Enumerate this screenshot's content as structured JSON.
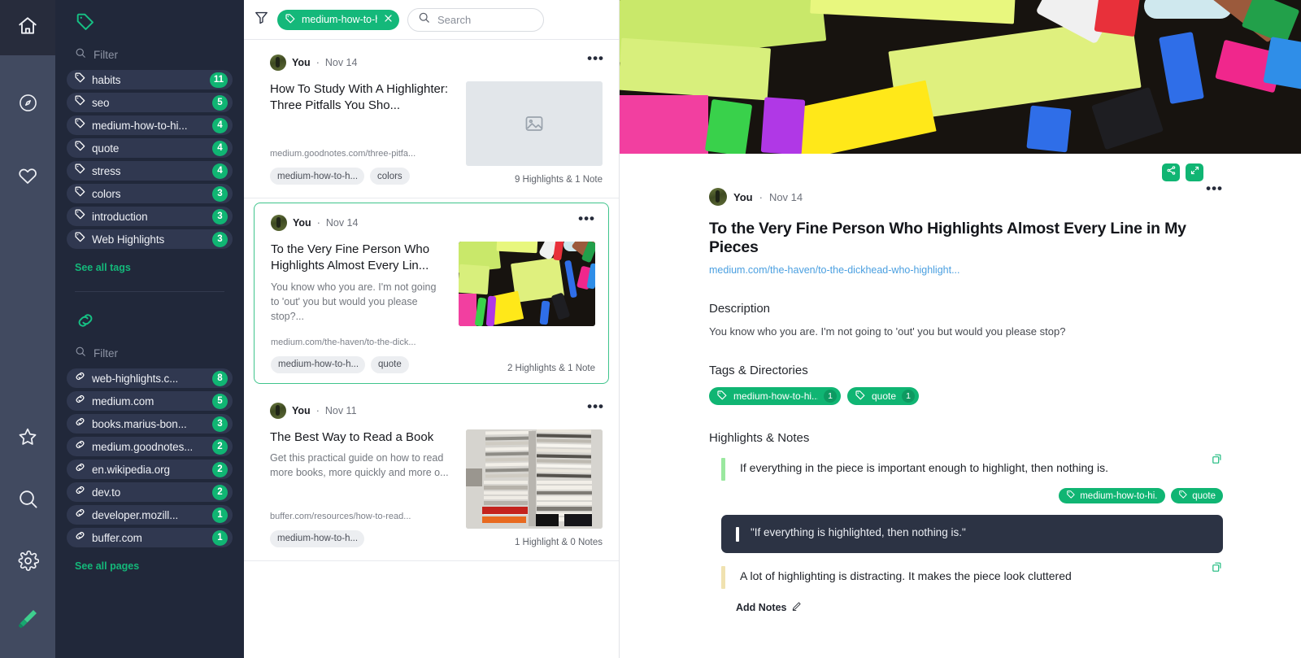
{
  "rail": {
    "icons": [
      {
        "name": "home-icon",
        "label": "Home"
      },
      {
        "name": "compass-icon",
        "label": "Discover"
      },
      {
        "name": "heart-icon",
        "label": "Favorites"
      },
      {
        "name": "star-icon",
        "label": "Starred"
      },
      {
        "name": "search-icon",
        "label": "Search"
      },
      {
        "name": "gear-icon",
        "label": "Settings"
      },
      {
        "name": "highlighter-icon",
        "label": "Highlighter"
      }
    ]
  },
  "sidebar": {
    "tags": {
      "header_icon": "tag-icon",
      "filter_placeholder": "Filter",
      "items": [
        {
          "label": "habits",
          "count": "11"
        },
        {
          "label": "seo",
          "count": "5"
        },
        {
          "label": "medium-how-to-hi...",
          "count": "4"
        },
        {
          "label": "quote",
          "count": "4"
        },
        {
          "label": "stress",
          "count": "4"
        },
        {
          "label": "colors",
          "count": "3"
        },
        {
          "label": "introduction",
          "count": "3"
        },
        {
          "label": "Web Highlights",
          "count": "3"
        }
      ],
      "see_all": "See all tags"
    },
    "pages": {
      "header_icon": "link-icon",
      "filter_placeholder": "Filter",
      "items": [
        {
          "label": "web-highlights.c...",
          "count": "8"
        },
        {
          "label": "medium.com",
          "count": "5"
        },
        {
          "label": "books.marius-bon...",
          "count": "3"
        },
        {
          "label": "medium.goodnotes...",
          "count": "2"
        },
        {
          "label": "en.wikipedia.org",
          "count": "2"
        },
        {
          "label": "dev.to",
          "count": "2"
        },
        {
          "label": "developer.mozill...",
          "count": "1"
        },
        {
          "label": "buffer.com",
          "count": "1"
        }
      ],
      "see_all": "See all pages"
    }
  },
  "list": {
    "filter_chip": {
      "label": "medium-how-to-hi...",
      "icon": "tag-icon",
      "close_icon": "close-icon"
    },
    "filter_icon": "funnel-icon",
    "search": {
      "placeholder": "Search",
      "value": "",
      "icon": "search-icon"
    },
    "cards": [
      {
        "author": "You",
        "separator": "·",
        "date": "Nov 14",
        "title": "How To Study With A Highlighter: Three Pitfalls You Sho...",
        "description": "",
        "url": "medium.goodnotes.com/three-pitfa...",
        "tags": [
          "medium-how-to-h...",
          "colors"
        ],
        "meta": "9 Highlights & 1 Note",
        "thumb": "placeholder",
        "selected": false
      },
      {
        "author": "You",
        "separator": "·",
        "date": "Nov 14",
        "title": "To the Very Fine Person Who Highlights Almost Every Lin...",
        "description": "You know who you are. I'm not going to 'out' you but would you please stop?...",
        "url": "medium.com/the-haven/to-the-dick...",
        "tags": [
          "medium-how-to-h...",
          "quote"
        ],
        "meta": "2 Highlights & 1 Note",
        "thumb": "supplies",
        "selected": true
      },
      {
        "author": "You",
        "separator": "·",
        "date": "Nov 11",
        "title": "The Best Way to Read a Book",
        "description": "Get this practical guide on how to read more books, more quickly and more o...",
        "url": "buffer.com/resources/how-to-read...",
        "tags": [
          "medium-how-to-h..."
        ],
        "meta": "1 Highlight & 0 Notes",
        "thumb": "books",
        "selected": false
      }
    ]
  },
  "detail": {
    "actions": [
      {
        "name": "share-icon",
        "label": "Share"
      },
      {
        "name": "expand-icon",
        "label": "Expand"
      }
    ],
    "more_icon": "more-options-icon",
    "author": "You",
    "separator": "·",
    "date": "Nov 14",
    "title": "To the Very Fine Person Who Highlights Almost Every Line in My Pieces",
    "url": "medium.com/the-haven/to-the-dickhead-who-highlight...",
    "description_heading": "Description",
    "description": "You know who you are. I'm not going to 'out' you but would you please stop?",
    "tags_heading": "Tags & Directories",
    "tags": [
      {
        "label": "medium-how-to-hi...",
        "count": "1"
      },
      {
        "label": "quote",
        "count": "1"
      }
    ],
    "highlights_heading": "Highlights & Notes",
    "highlights": [
      {
        "text": "If everything in the piece is important enough to highlight, then nothing is.",
        "bar_color": "#9ae89f",
        "tags": [
          "medium-how-to-hi...",
          "quote"
        ],
        "note": "\"If everything is highlighted, then nothing is.\"",
        "copy_icon": "copy-icon"
      },
      {
        "text": "A lot of highlighting is distracting. It makes the piece look cluttered",
        "bar_color": "#f0e2b0",
        "tags": [],
        "note": "",
        "copy_icon": "copy-icon"
      }
    ],
    "add_notes_label": "Add Notes",
    "add_notes_icon": "pencil-icon"
  },
  "colors": {
    "accent_green": "#10b573",
    "rail_bg": "#414a60",
    "rail_active_bg": "#272c3c",
    "sidebar_bg": "#21283a",
    "note_bg": "#2c3344",
    "link_blue": "#4a9fe0"
  }
}
